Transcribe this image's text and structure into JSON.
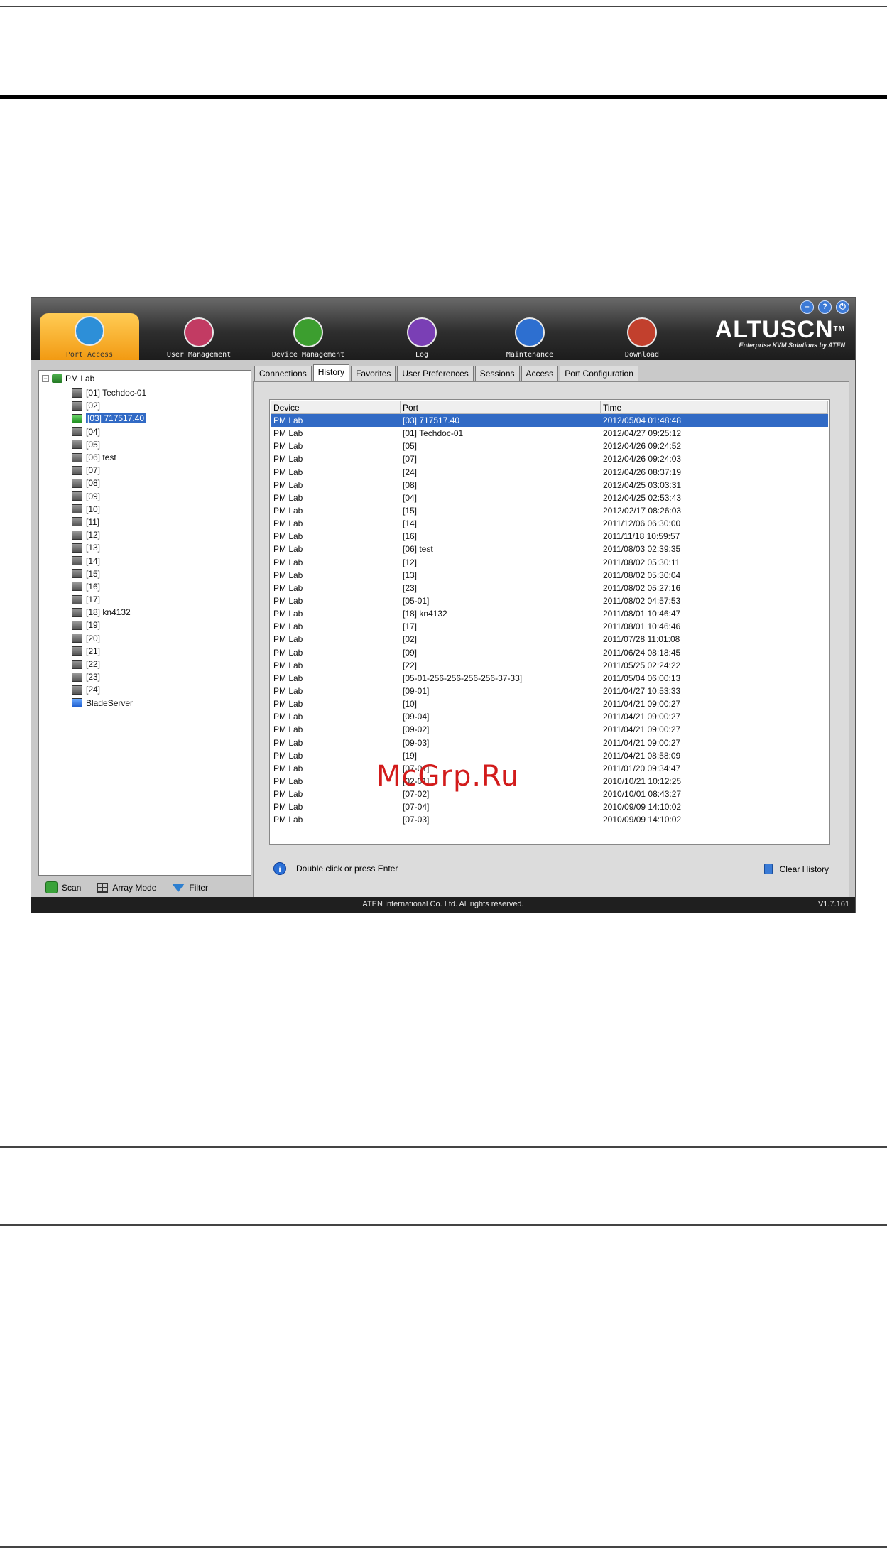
{
  "app": {
    "brand": "ALTUSCN",
    "brand_tm": "TM",
    "brand_sub": "Enterprise KVM Solutions by ATEN",
    "window_buttons": [
      "minimize-icon",
      "help-icon",
      "logout-icon"
    ],
    "modules": [
      {
        "label": "Port Access",
        "icon": "port-access-icon",
        "active": true,
        "color": "#2d8fd8"
      },
      {
        "label": "User Management",
        "icon": "user-management-icon",
        "active": false,
        "color": "#c23b63"
      },
      {
        "label": "Device Management",
        "icon": "device-management-icon",
        "active": false,
        "color": "#3c9e2f"
      },
      {
        "label": "Log",
        "icon": "log-icon",
        "active": false,
        "color": "#7a3fb5"
      },
      {
        "label": "Maintenance",
        "icon": "maintenance-icon",
        "active": false,
        "color": "#2d6fd0"
      },
      {
        "label": "Download",
        "icon": "download-icon",
        "active": false,
        "color": "#c2402d"
      }
    ]
  },
  "tree": {
    "root": "PM Lab",
    "items": [
      {
        "label": "[01] Techdoc-01",
        "selected": false,
        "online": false
      },
      {
        "label": "[02]",
        "selected": false,
        "online": false
      },
      {
        "label": "[03] 717517.40",
        "selected": true,
        "online": true
      },
      {
        "label": "[04]",
        "selected": false,
        "online": false
      },
      {
        "label": "[05]",
        "selected": false,
        "online": false
      },
      {
        "label": "[06] test",
        "selected": false,
        "online": false
      },
      {
        "label": "[07]",
        "selected": false,
        "online": false
      },
      {
        "label": "[08]",
        "selected": false,
        "online": false
      },
      {
        "label": "[09]",
        "selected": false,
        "online": false
      },
      {
        "label": "[10]",
        "selected": false,
        "online": false
      },
      {
        "label": "[11]",
        "selected": false,
        "online": false
      },
      {
        "label": "[12]",
        "selected": false,
        "online": false
      },
      {
        "label": "[13]",
        "selected": false,
        "online": false
      },
      {
        "label": "[14]",
        "selected": false,
        "online": false
      },
      {
        "label": "[15]",
        "selected": false,
        "online": false
      },
      {
        "label": "[16]",
        "selected": false,
        "online": false
      },
      {
        "label": "[17]",
        "selected": false,
        "online": false
      },
      {
        "label": "[18] kn4132",
        "selected": false,
        "online": false
      },
      {
        "label": "[19]",
        "selected": false,
        "online": false
      },
      {
        "label": "[20]",
        "selected": false,
        "online": false
      },
      {
        "label": "[21]",
        "selected": false,
        "online": false
      },
      {
        "label": "[22]",
        "selected": false,
        "online": false
      },
      {
        "label": "[23]",
        "selected": false,
        "online": false
      },
      {
        "label": "[24]",
        "selected": false,
        "online": false
      },
      {
        "label": "BladeServer",
        "selected": false,
        "online": false,
        "blade": true
      }
    ]
  },
  "left_actions": {
    "scan": "Scan",
    "array_mode": "Array Mode",
    "filter": "Filter"
  },
  "tabs": [
    {
      "label": "Connections",
      "active": false
    },
    {
      "label": "History",
      "active": true
    },
    {
      "label": "Favorites",
      "active": false
    },
    {
      "label": "User Preferences",
      "active": false
    },
    {
      "label": "Sessions",
      "active": false
    },
    {
      "label": "Access",
      "active": false
    },
    {
      "label": "Port Configuration",
      "active": false
    }
  ],
  "history": {
    "columns": [
      "Device",
      "Port",
      "Time"
    ],
    "rows": [
      [
        "PM Lab",
        "[03] 717517.40",
        "2012/05/04 01:48:48"
      ],
      [
        "PM Lab",
        "[01] Techdoc-01",
        "2012/04/27 09:25:12"
      ],
      [
        "PM Lab",
        "[05]",
        "2012/04/26 09:24:52"
      ],
      [
        "PM Lab",
        "[07]",
        "2012/04/26 09:24:03"
      ],
      [
        "PM Lab",
        "[24]",
        "2012/04/26 08:37:19"
      ],
      [
        "PM Lab",
        "[08]",
        "2012/04/25 03:03:31"
      ],
      [
        "PM Lab",
        "[04]",
        "2012/04/25 02:53:43"
      ],
      [
        "PM Lab",
        "[15]",
        "2012/02/17 08:26:03"
      ],
      [
        "PM Lab",
        "[14]",
        "2011/12/06 06:30:00"
      ],
      [
        "PM Lab",
        "[16]",
        "2011/11/18 10:59:57"
      ],
      [
        "PM Lab",
        "[06] test",
        "2011/08/03 02:39:35"
      ],
      [
        "PM Lab",
        "[12]",
        "2011/08/02 05:30:11"
      ],
      [
        "PM Lab",
        "[13]",
        "2011/08/02 05:30:04"
      ],
      [
        "PM Lab",
        "[23]",
        "2011/08/02 05:27:16"
      ],
      [
        "PM Lab",
        "[05-01]",
        "2011/08/02 04:57:53"
      ],
      [
        "PM Lab",
        "[18] kn4132",
        "2011/08/01 10:46:47"
      ],
      [
        "PM Lab",
        "[17]",
        "2011/08/01 10:46:46"
      ],
      [
        "PM Lab",
        "[02]",
        "2011/07/28 11:01:08"
      ],
      [
        "PM Lab",
        "[09]",
        "2011/06/24 08:18:45"
      ],
      [
        "PM Lab",
        "[22]",
        "2011/05/25 02:24:22"
      ],
      [
        "PM Lab",
        "[05-01-256-256-256-256-37-33]",
        "2011/05/04 06:00:13"
      ],
      [
        "PM Lab",
        "[09-01]",
        "2011/04/27 10:53:33"
      ],
      [
        "PM Lab",
        "[10]",
        "2011/04/21 09:00:27"
      ],
      [
        "PM Lab",
        "[09-04]",
        "2011/04/21 09:00:27"
      ],
      [
        "PM Lab",
        "[09-02]",
        "2011/04/21 09:00:27"
      ],
      [
        "PM Lab",
        "[09-03]",
        "2011/04/21 09:00:27"
      ],
      [
        "PM Lab",
        "[19]",
        "2011/04/21 08:58:09"
      ],
      [
        "PM Lab",
        "[07-01]",
        "2011/01/20 09:34:47"
      ],
      [
        "PM Lab",
        "[02-01]",
        "2010/10/21 10:12:25"
      ],
      [
        "PM Lab",
        "[07-02]",
        "2010/10/01 08:43:27"
      ],
      [
        "PM Lab",
        "[07-04]",
        "2010/09/09 14:10:02"
      ],
      [
        "PM Lab",
        "[07-03]",
        "2010/09/09 14:10:02"
      ]
    ],
    "hint": "Double click or press Enter",
    "clear_label": "Clear History"
  },
  "status": {
    "copyright": "ATEN International Co. Ltd. All rights reserved.",
    "version": "V1.7.161"
  },
  "watermark": "McGrp.Ru",
  "colors": {
    "selection": "#316ac5",
    "active_module": "#f29a12",
    "watermark": "#d21b1b"
  }
}
